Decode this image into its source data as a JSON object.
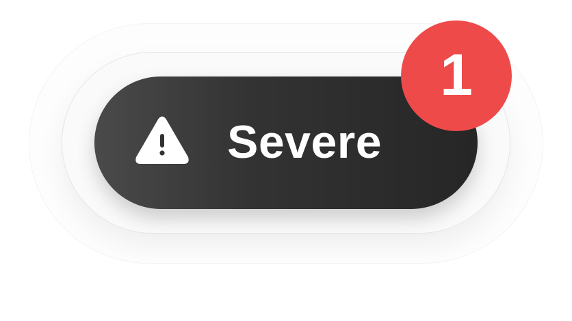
{
  "alert_button": {
    "label": "Severe",
    "icon": "warning-triangle-icon",
    "badge_count": "1"
  },
  "colors": {
    "pill_start": "#4a4a4a",
    "pill_end": "#262626",
    "badge": "#ef4a4a",
    "text": "#ffffff"
  }
}
